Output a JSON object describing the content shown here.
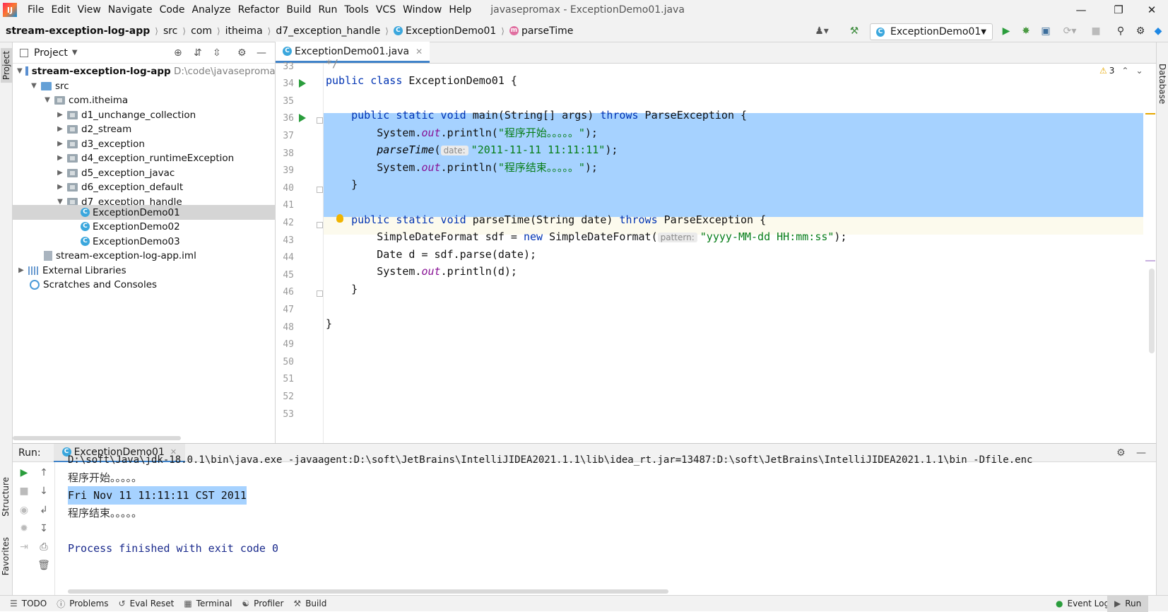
{
  "menubar": {
    "items": [
      "File",
      "Edit",
      "View",
      "Navigate",
      "Code",
      "Analyze",
      "Refactor",
      "Build",
      "Run",
      "Tools",
      "VCS",
      "Window",
      "Help"
    ],
    "title": "javasepromax - ExceptionDemo01.java"
  },
  "navbar": {
    "crumbs": [
      "stream-exception-log-app",
      "src",
      "com",
      "itheima",
      "d7_exception_handle",
      "ExceptionDemo01",
      "parseTime"
    ],
    "run_config": "ExceptionDemo01"
  },
  "project": {
    "title": "Project",
    "tree": [
      {
        "label": "stream-exception-log-app",
        "extra": "D:\\code\\javasepromax\\",
        "type": "module"
      },
      {
        "label": "src",
        "type": "srcfolder"
      },
      {
        "label": "com.itheima",
        "type": "package"
      },
      {
        "label": "d1_unchange_collection",
        "type": "package"
      },
      {
        "label": "d2_stream",
        "type": "package"
      },
      {
        "label": "d3_exception",
        "type": "package"
      },
      {
        "label": "d4_exception_runtimeException",
        "type": "package"
      },
      {
        "label": "d5_exception_javac",
        "type": "package"
      },
      {
        "label": "d6_exception_default",
        "type": "package"
      },
      {
        "label": "d7_exception_handle",
        "type": "package"
      },
      {
        "label": "ExceptionDemo01",
        "type": "class"
      },
      {
        "label": "ExceptionDemo02",
        "type": "class"
      },
      {
        "label": "ExceptionDemo03",
        "type": "class"
      },
      {
        "label": "stream-exception-log-app.iml",
        "type": "iml"
      },
      {
        "label": "External Libraries",
        "type": "lib"
      },
      {
        "label": "Scratches and Consoles",
        "type": "scratch"
      }
    ]
  },
  "editor": {
    "tab": "ExceptionDemo01.java",
    "warnings": "3",
    "line_numbers": [
      "33",
      "34",
      "35",
      "36",
      "37",
      "38",
      "39",
      "40",
      "41",
      "42",
      "43",
      "44",
      "45",
      "46",
      "47",
      "48",
      "49",
      "50",
      "51",
      "52",
      "53"
    ],
    "code": {
      "l33": "*/",
      "l34_kw": "public class",
      "l34_rest": " ExceptionDemo01 {",
      "l36_kw": "public static void",
      "l36_a": " main(String[] args) ",
      "l36_throws": "throws",
      "l36_b": " ParseException {",
      "l37_a": "System.",
      "l37_out": "out",
      "l37_b": ".println(",
      "l37_str": "\"程序开始。。。。。\"",
      "l37_c": ");",
      "l38_fn": "parseTime",
      "l38_a": "(",
      "l38_hint": "date:",
      "l38_str": "\"2011-11-11 11:11:11\"",
      "l38_b": ");",
      "l39_a": "System.",
      "l39_out": "out",
      "l39_b": ".println(",
      "l39_str": "\"程序结束。。。。。\"",
      "l39_c": ");",
      "l40": "}",
      "l42_kw": "public static void",
      "l42_a": " parseTime(String date) ",
      "l42_throws": "throws",
      "l42_b": " ParseException {",
      "l43_a": "SimpleDateFormat sdf = ",
      "l43_new": "new",
      "l43_b": " SimpleDateFormat(",
      "l43_hint": "pattern:",
      "l43_str": "\"yyyy-MM-dd HH:mm:ss\"",
      "l43_c": ");",
      "l44": "Date d = sdf.parse(date);",
      "l45_a": "System.",
      "l45_out": "out",
      "l45_b": ".println(d);",
      "l46": "}",
      "l48": "}"
    }
  },
  "run": {
    "label": "Run:",
    "tab": "ExceptionDemo01",
    "console": [
      "D:\\soft\\Java\\jdk-18.0.1\\bin\\java.exe -javaagent:D:\\soft\\JetBrains\\IntelliJIDEA2021.1.1\\lib\\idea_rt.jar=13487:D:\\soft\\JetBrains\\IntelliJIDEA2021.1.1\\bin -Dfile.enc",
      "程序开始。。。。。",
      "Fri Nov 11 11:11:11 CST 2011",
      "程序结束。。。。。",
      "",
      "Process finished with exit code 0"
    ]
  },
  "sidebars": {
    "left_top": "Project",
    "left_structure": "Structure",
    "left_favorites": "Favorites",
    "right": "Database"
  },
  "statusbar": {
    "items": [
      "TODO",
      "Problems",
      "Eval Reset",
      "Terminal",
      "Profiler",
      "Build"
    ],
    "event_log": "Event Log",
    "run": "Run"
  }
}
